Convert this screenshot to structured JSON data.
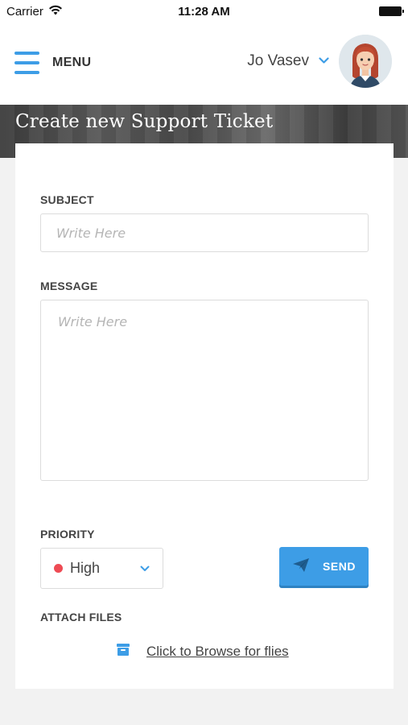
{
  "status_bar": {
    "carrier": "Carrier",
    "time": "11:28 AM"
  },
  "header": {
    "menu_label": "MENU",
    "user_name": "Jo Vasev"
  },
  "page": {
    "title": "Create new Support Ticket"
  },
  "form": {
    "subject": {
      "label": "SUBJECT",
      "placeholder": "Write Here",
      "value": ""
    },
    "message": {
      "label": "MESSAGE",
      "placeholder": "Write Here",
      "value": ""
    },
    "priority": {
      "label": "PRIORITY",
      "selected": "High",
      "indicator_color": "#ee4b54"
    },
    "send_label": "SEND",
    "attach": {
      "label": "ATTACH FILES",
      "link_text": "Click to Browse for flies"
    }
  },
  "colors": {
    "accent": "#3d9de6",
    "priority_high": "#ee4b54"
  },
  "icons": {
    "menu": "hamburger-icon",
    "user_dropdown": "chevron-down-icon",
    "priority_dropdown": "chevron-down-icon",
    "send": "paper-plane-icon",
    "attach": "archive-box-icon",
    "wifi": "wifi-icon",
    "battery": "battery-icon"
  }
}
